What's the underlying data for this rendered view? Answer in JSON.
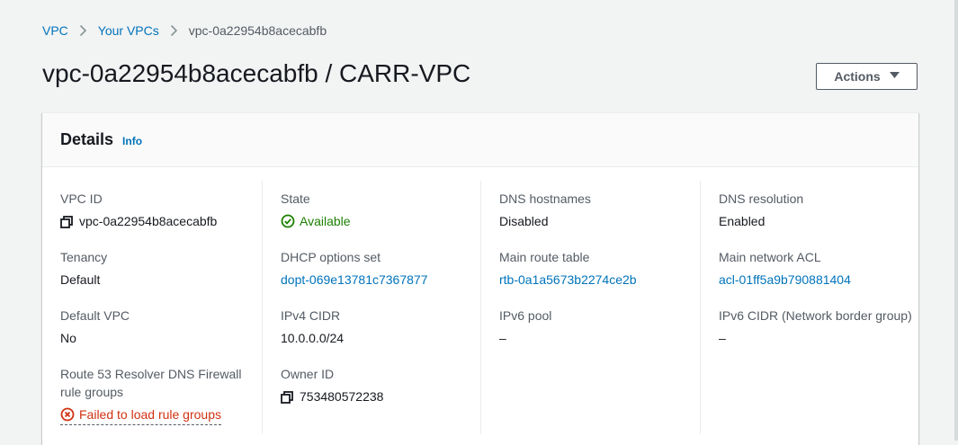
{
  "breadcrumb": {
    "items": [
      {
        "label": "VPC"
      },
      {
        "label": "Your VPCs"
      }
    ],
    "current": "vpc-0a22954b8acecabfb"
  },
  "page": {
    "title": "vpc-0a22954b8acecabfb / CARR-VPC",
    "actions_label": "Actions"
  },
  "details": {
    "title": "Details",
    "info_label": "Info",
    "fields": {
      "vpc_id": {
        "label": "VPC ID",
        "value": "vpc-0a22954b8acecabfb"
      },
      "tenancy": {
        "label": "Tenancy",
        "value": "Default"
      },
      "default_vpc": {
        "label": "Default VPC",
        "value": "No"
      },
      "resolver_dns_firewall": {
        "label": "Route 53 Resolver DNS Firewall rule groups",
        "value": "Failed to load rule groups"
      },
      "state": {
        "label": "State",
        "value": "Available"
      },
      "dhcp_options_set": {
        "label": "DHCP options set",
        "value": "dopt-069e13781c7367877"
      },
      "ipv4_cidr": {
        "label": "IPv4 CIDR",
        "value": "10.0.0.0/24"
      },
      "owner_id": {
        "label": "Owner ID",
        "value": "753480572238"
      },
      "dns_hostnames": {
        "label": "DNS hostnames",
        "value": "Disabled"
      },
      "main_route_table": {
        "label": "Main route table",
        "value": "rtb-0a1a5673b2274ce2b"
      },
      "ipv6_pool": {
        "label": "IPv6 pool",
        "value": "–"
      },
      "dns_resolution": {
        "label": "DNS resolution",
        "value": "Enabled"
      },
      "main_network_acl": {
        "label": "Main network ACL",
        "value": "acl-01ff5a9b790881404"
      },
      "ipv6_cidr": {
        "label": "IPv6 CIDR (Network border group)",
        "value": "–"
      }
    }
  },
  "colors": {
    "link": "#0073bb",
    "success": "#1d8102",
    "error": "#d13212",
    "text": "#16191f",
    "label": "#545b64",
    "background": "#f2f3f3"
  },
  "icons": {
    "chevron": "chevron-right-icon",
    "copy": "copy-icon",
    "status_ok": "check-circle-icon",
    "status_error": "x-circle-icon",
    "caret": "caret-down-icon"
  }
}
